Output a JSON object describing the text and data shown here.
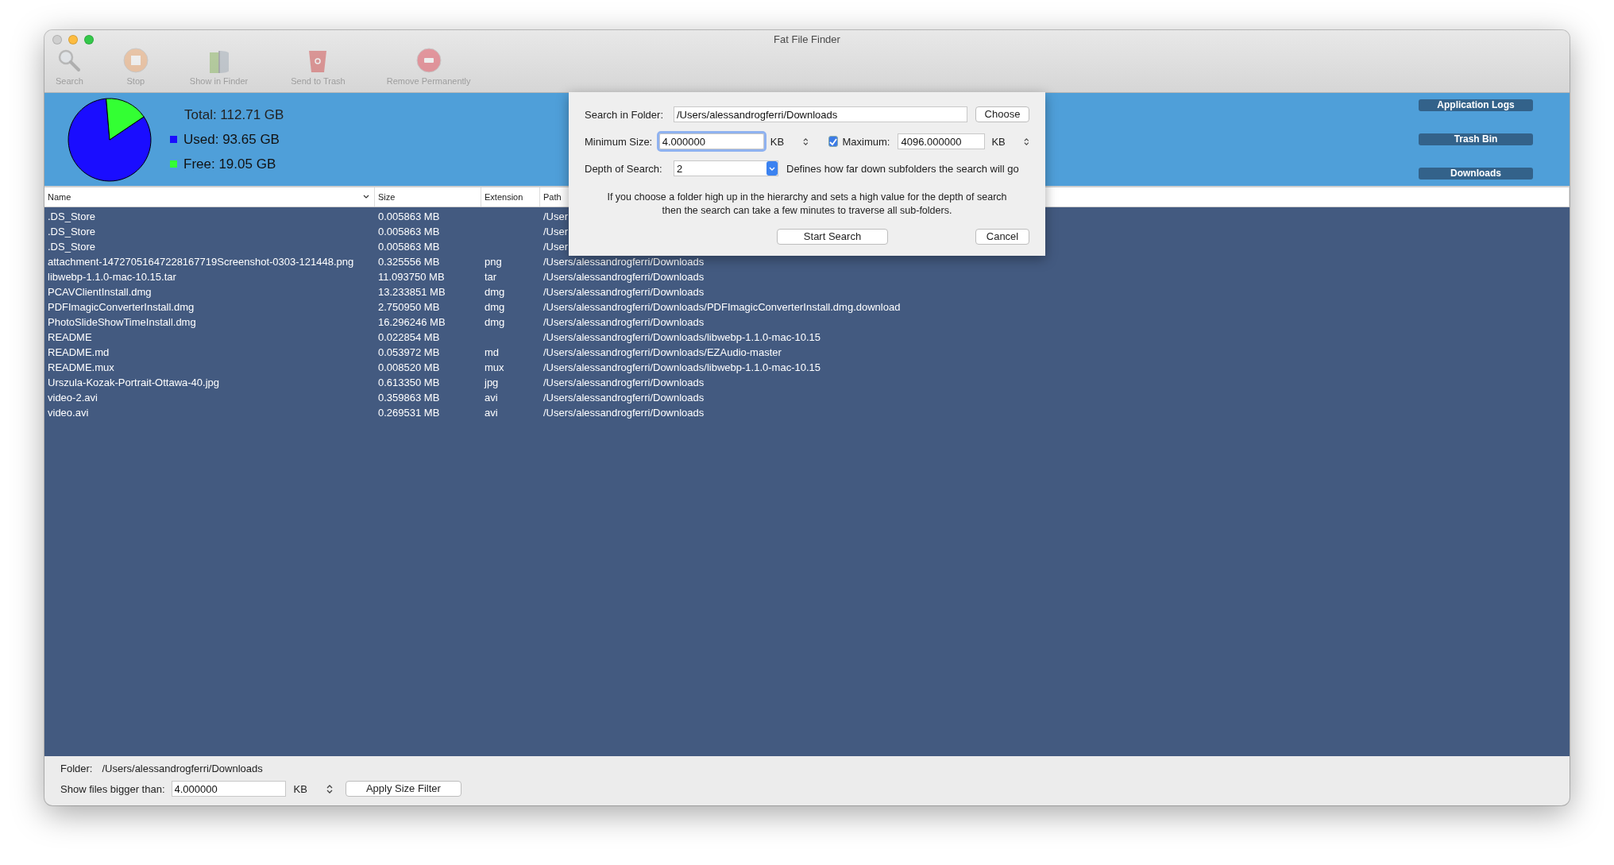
{
  "window": {
    "title": "Fat File Finder"
  },
  "toolbar": [
    {
      "kind": "search",
      "label": "Search",
      "disabled": true
    },
    {
      "kind": "stop",
      "label": "Stop",
      "disabled": true
    },
    {
      "kind": "finder",
      "label": "Show in Finder",
      "disabled": true
    },
    {
      "kind": "trash",
      "label": "Send to Trash",
      "disabled": true
    },
    {
      "kind": "remove",
      "label": "Remove Permanently",
      "disabled": true
    }
  ],
  "summary": {
    "total": "Total: 112.71 GB",
    "legend": [
      {
        "color": "#1a0dff"
      },
      {
        "color": "#33ff33"
      }
    ],
    "chart_data": {
      "type": "pie",
      "categories": [
        "Used: 93.65 GB",
        "Free: 19.05 GB"
      ],
      "values": [
        93.65,
        19.05
      ]
    }
  },
  "shortcuts": [
    "Application Logs",
    "Trash Bin",
    "Downloads"
  ],
  "table": {
    "columns": [
      "Name",
      "Size",
      "Extension",
      "Path"
    ],
    "rows": [
      [
        ".DS_Store",
        "0.005863 MB",
        "",
        "/User"
      ],
      [
        ".DS_Store",
        "0.005863 MB",
        "",
        "/User"
      ],
      [
        ".DS_Store",
        "0.005863 MB",
        "",
        "/User"
      ],
      [
        "attachment-14727051647228167719Screenshot-0303-121448.png",
        "0.325556 MB",
        "png",
        "/Users/alessandrogferri/Downloads"
      ],
      [
        "libwebp-1.1.0-mac-10.15.tar",
        "11.093750 MB",
        "tar",
        "/Users/alessandrogferri/Downloads"
      ],
      [
        "PCAVClientInstall.dmg",
        "13.233851 MB",
        "dmg",
        "/Users/alessandrogferri/Downloads"
      ],
      [
        "PDFImagicConverterInstall.dmg",
        "2.750950 MB",
        "dmg",
        "/Users/alessandrogferri/Downloads/PDFImagicConverterInstall.dmg.download"
      ],
      [
        "PhotoSlideShowTimeInstall.dmg",
        "16.296246 MB",
        "dmg",
        "/Users/alessandrogferri/Downloads"
      ],
      [
        "README",
        "0.022854 MB",
        "",
        "/Users/alessandrogferri/Downloads/libwebp-1.1.0-mac-10.15"
      ],
      [
        "README.md",
        "0.053972 MB",
        "md",
        "/Users/alessandrogferri/Downloads/EZAudio-master"
      ],
      [
        "README.mux",
        "0.008520 MB",
        "mux",
        "/Users/alessandrogferri/Downloads/libwebp-1.1.0-mac-10.15"
      ],
      [
        "Urszula-Kozak-Portrait-Ottawa-40.jpg",
        "0.613350 MB",
        "jpg",
        "/Users/alessandrogferri/Downloads"
      ],
      [
        "video-2.avi",
        "0.359863 MB",
        "avi",
        "/Users/alessandrogferri/Downloads"
      ],
      [
        "video.avi",
        "0.269531 MB",
        "avi",
        "/Users/alessandrogferri/Downloads"
      ]
    ]
  },
  "bottom": {
    "folder_label": "Folder:",
    "folder": "/Users/alessandrogferri/Downloads",
    "filter_label": "Show files bigger than:",
    "filter_value": "4.000000",
    "unit": "KB",
    "apply": "Apply Size Filter"
  },
  "dialog": {
    "folder_label": "Search in Folder:",
    "folder": "/Users/alessandrogferri/Downloads",
    "choose": "Choose",
    "min_label": "Minimum Size:",
    "min_value": "4.000000",
    "min_unit": "KB",
    "max_checked": true,
    "max_label": "Maximum:",
    "max_value": "4096.000000",
    "max_unit": "KB",
    "depth_label": "Depth of Search:",
    "depth_value": "2",
    "depth_help": "Defines how far down subfolders the search will go",
    "note": "If you choose a folder high up in the hierarchy and sets a high value for the depth of search then the search can take a few minutes to traverse all sub-folders.",
    "start": "Start Search",
    "cancel": "Cancel"
  }
}
